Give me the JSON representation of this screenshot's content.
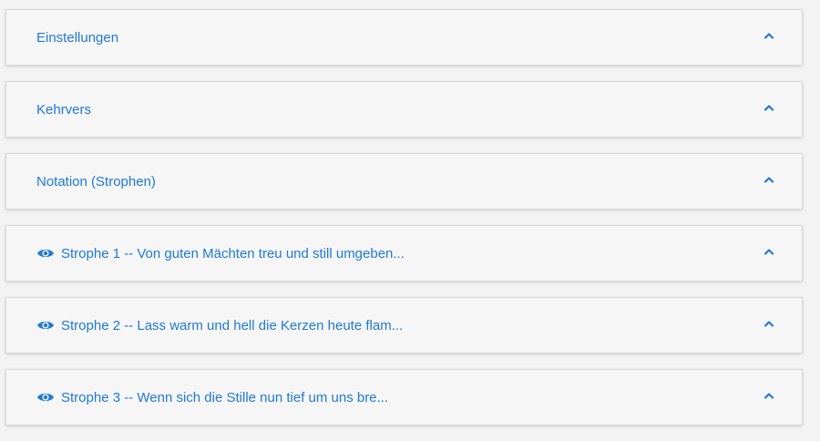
{
  "colors": {
    "accent": "#1f7ad6",
    "panel_bg": "#f6f6f7",
    "page_bg": "#f3f3f4"
  },
  "panels": [
    {
      "label": "Einstellungen",
      "icon": "",
      "expanded": false
    },
    {
      "label": "Kehrvers",
      "icon": "",
      "expanded": false
    },
    {
      "label": "Notation (Strophen)",
      "icon": "",
      "expanded": false
    },
    {
      "label": "Strophe 1 -- Von guten Mächten treu und still umgeben...",
      "icon": "eye-icon",
      "expanded": false
    },
    {
      "label": "Strophe 2 -- Lass warm und hell die Kerzen heute flam...",
      "icon": "eye-icon",
      "expanded": false
    },
    {
      "label": "Strophe 3 -- Wenn sich die Stille nun tief um uns bre...",
      "icon": "eye-icon",
      "expanded": false
    }
  ]
}
